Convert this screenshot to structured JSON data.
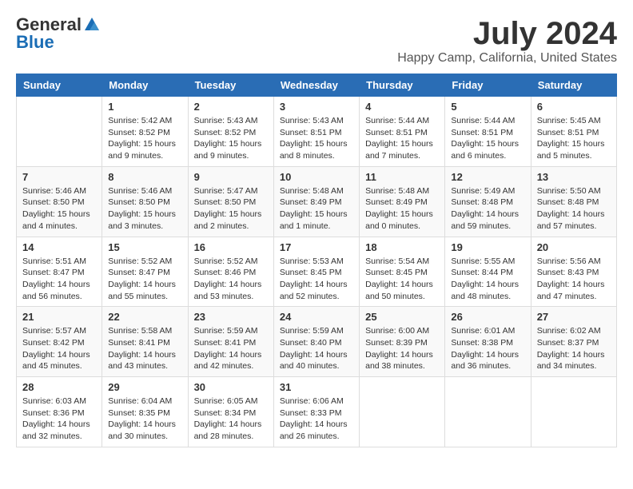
{
  "logo": {
    "general": "General",
    "blue": "Blue"
  },
  "title": {
    "month_year": "July 2024",
    "location": "Happy Camp, California, United States"
  },
  "headers": [
    "Sunday",
    "Monday",
    "Tuesday",
    "Wednesday",
    "Thursday",
    "Friday",
    "Saturday"
  ],
  "weeks": [
    [
      {
        "day": "",
        "info": ""
      },
      {
        "day": "1",
        "info": "Sunrise: 5:42 AM\nSunset: 8:52 PM\nDaylight: 15 hours\nand 9 minutes."
      },
      {
        "day": "2",
        "info": "Sunrise: 5:43 AM\nSunset: 8:52 PM\nDaylight: 15 hours\nand 9 minutes."
      },
      {
        "day": "3",
        "info": "Sunrise: 5:43 AM\nSunset: 8:51 PM\nDaylight: 15 hours\nand 8 minutes."
      },
      {
        "day": "4",
        "info": "Sunrise: 5:44 AM\nSunset: 8:51 PM\nDaylight: 15 hours\nand 7 minutes."
      },
      {
        "day": "5",
        "info": "Sunrise: 5:44 AM\nSunset: 8:51 PM\nDaylight: 15 hours\nand 6 minutes."
      },
      {
        "day": "6",
        "info": "Sunrise: 5:45 AM\nSunset: 8:51 PM\nDaylight: 15 hours\nand 5 minutes."
      }
    ],
    [
      {
        "day": "7",
        "info": "Sunrise: 5:46 AM\nSunset: 8:50 PM\nDaylight: 15 hours\nand 4 minutes."
      },
      {
        "day": "8",
        "info": "Sunrise: 5:46 AM\nSunset: 8:50 PM\nDaylight: 15 hours\nand 3 minutes."
      },
      {
        "day": "9",
        "info": "Sunrise: 5:47 AM\nSunset: 8:50 PM\nDaylight: 15 hours\nand 2 minutes."
      },
      {
        "day": "10",
        "info": "Sunrise: 5:48 AM\nSunset: 8:49 PM\nDaylight: 15 hours\nand 1 minute."
      },
      {
        "day": "11",
        "info": "Sunrise: 5:48 AM\nSunset: 8:49 PM\nDaylight: 15 hours\nand 0 minutes."
      },
      {
        "day": "12",
        "info": "Sunrise: 5:49 AM\nSunset: 8:48 PM\nDaylight: 14 hours\nand 59 minutes."
      },
      {
        "day": "13",
        "info": "Sunrise: 5:50 AM\nSunset: 8:48 PM\nDaylight: 14 hours\nand 57 minutes."
      }
    ],
    [
      {
        "day": "14",
        "info": "Sunrise: 5:51 AM\nSunset: 8:47 PM\nDaylight: 14 hours\nand 56 minutes."
      },
      {
        "day": "15",
        "info": "Sunrise: 5:52 AM\nSunset: 8:47 PM\nDaylight: 14 hours\nand 55 minutes."
      },
      {
        "day": "16",
        "info": "Sunrise: 5:52 AM\nSunset: 8:46 PM\nDaylight: 14 hours\nand 53 minutes."
      },
      {
        "day": "17",
        "info": "Sunrise: 5:53 AM\nSunset: 8:45 PM\nDaylight: 14 hours\nand 52 minutes."
      },
      {
        "day": "18",
        "info": "Sunrise: 5:54 AM\nSunset: 8:45 PM\nDaylight: 14 hours\nand 50 minutes."
      },
      {
        "day": "19",
        "info": "Sunrise: 5:55 AM\nSunset: 8:44 PM\nDaylight: 14 hours\nand 48 minutes."
      },
      {
        "day": "20",
        "info": "Sunrise: 5:56 AM\nSunset: 8:43 PM\nDaylight: 14 hours\nand 47 minutes."
      }
    ],
    [
      {
        "day": "21",
        "info": "Sunrise: 5:57 AM\nSunset: 8:42 PM\nDaylight: 14 hours\nand 45 minutes."
      },
      {
        "day": "22",
        "info": "Sunrise: 5:58 AM\nSunset: 8:41 PM\nDaylight: 14 hours\nand 43 minutes."
      },
      {
        "day": "23",
        "info": "Sunrise: 5:59 AM\nSunset: 8:41 PM\nDaylight: 14 hours\nand 42 minutes."
      },
      {
        "day": "24",
        "info": "Sunrise: 5:59 AM\nSunset: 8:40 PM\nDaylight: 14 hours\nand 40 minutes."
      },
      {
        "day": "25",
        "info": "Sunrise: 6:00 AM\nSunset: 8:39 PM\nDaylight: 14 hours\nand 38 minutes."
      },
      {
        "day": "26",
        "info": "Sunrise: 6:01 AM\nSunset: 8:38 PM\nDaylight: 14 hours\nand 36 minutes."
      },
      {
        "day": "27",
        "info": "Sunrise: 6:02 AM\nSunset: 8:37 PM\nDaylight: 14 hours\nand 34 minutes."
      }
    ],
    [
      {
        "day": "28",
        "info": "Sunrise: 6:03 AM\nSunset: 8:36 PM\nDaylight: 14 hours\nand 32 minutes."
      },
      {
        "day": "29",
        "info": "Sunrise: 6:04 AM\nSunset: 8:35 PM\nDaylight: 14 hours\nand 30 minutes."
      },
      {
        "day": "30",
        "info": "Sunrise: 6:05 AM\nSunset: 8:34 PM\nDaylight: 14 hours\nand 28 minutes."
      },
      {
        "day": "31",
        "info": "Sunrise: 6:06 AM\nSunset: 8:33 PM\nDaylight: 14 hours\nand 26 minutes."
      },
      {
        "day": "",
        "info": ""
      },
      {
        "day": "",
        "info": ""
      },
      {
        "day": "",
        "info": ""
      }
    ]
  ]
}
